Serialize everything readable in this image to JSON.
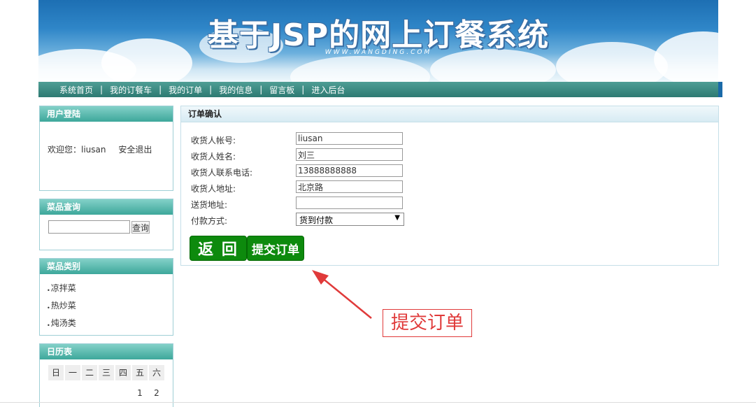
{
  "header": {
    "title": "基于JSP的网上订餐系统",
    "subtitle": "WWW.WANGDING.COM"
  },
  "nav": {
    "items": [
      "系统首页",
      "我的订餐车",
      "我的订单",
      "我的信息",
      "留言板",
      "进入后台"
    ]
  },
  "login_box": {
    "title": "用户登陆",
    "welcome_label": "欢迎您：",
    "username": "liusan",
    "logout_label": "安全退出"
  },
  "search_box": {
    "title": "菜品查询",
    "input_value": "",
    "button_label": "查询"
  },
  "category_box": {
    "title": "菜品类别",
    "items": [
      "凉拌菜",
      "热炒菜",
      "炖汤类"
    ]
  },
  "calendar_box": {
    "title": "日历表",
    "weekdays": [
      "日",
      "一",
      "二",
      "三",
      "四",
      "五",
      "六"
    ],
    "first_row": [
      "",
      "",
      "",
      "",
      "",
      "1",
      "2"
    ]
  },
  "order_confirm": {
    "title": "订单确认",
    "fields": [
      {
        "label": "收货人帐号:",
        "value": "liusan"
      },
      {
        "label": "收货人姓名:",
        "value": "刘三"
      },
      {
        "label": "收货人联系电话:",
        "value": "13888888888"
      },
      {
        "label": "收货人地址:",
        "value": "北京路"
      },
      {
        "label": "送货地址:",
        "value": ""
      }
    ],
    "payment_label": "付款方式:",
    "payment_selected": "货到付款",
    "back_button": "返 回",
    "submit_button": "提交订单"
  },
  "annotation": {
    "text": "提交订单",
    "color": "#e03a3a"
  },
  "colors": {
    "nav_bg": "#2d7a72",
    "box_header": "#3da79b",
    "button_green": "#0d8a0d"
  }
}
